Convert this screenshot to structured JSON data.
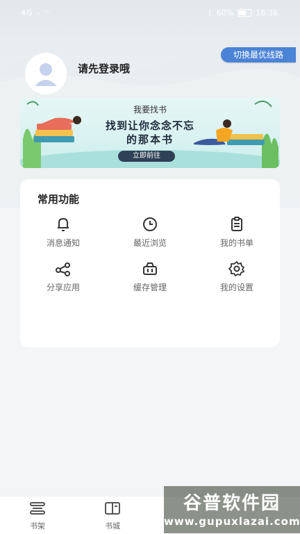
{
  "status_bar": {
    "left": "4G ᵢₗ ⌔",
    "battery": "60%",
    "time": "18:38"
  },
  "header": {
    "switch_line": "切换最优线路",
    "login_prompt": "请先登录哦"
  },
  "banner": {
    "top_text": "我要找书",
    "title_line1": "找到让你念念不忘",
    "title_line2": "的那本书",
    "button": "立即前往"
  },
  "functions": {
    "title": "常用功能",
    "items": [
      {
        "label": "消息通知",
        "icon": "bell-icon"
      },
      {
        "label": "最近浏览",
        "icon": "clock-icon"
      },
      {
        "label": "我的书单",
        "icon": "clipboard-icon"
      },
      {
        "label": "分享应用",
        "icon": "share-icon"
      },
      {
        "label": "缓存管理",
        "icon": "basket-icon"
      },
      {
        "label": "我的设置",
        "icon": "gear-icon"
      }
    ]
  },
  "bottom_nav": {
    "items": [
      {
        "label": "书架",
        "icon": "bookshelf-icon"
      },
      {
        "label": "书城",
        "icon": "open-book-icon"
      }
    ]
  },
  "watermark": {
    "top": "谷普软件园",
    "bottom": "www.gupuxlazai.com"
  },
  "colors": {
    "accent": "#4b83d6",
    "banner_button": "#2e4156"
  }
}
